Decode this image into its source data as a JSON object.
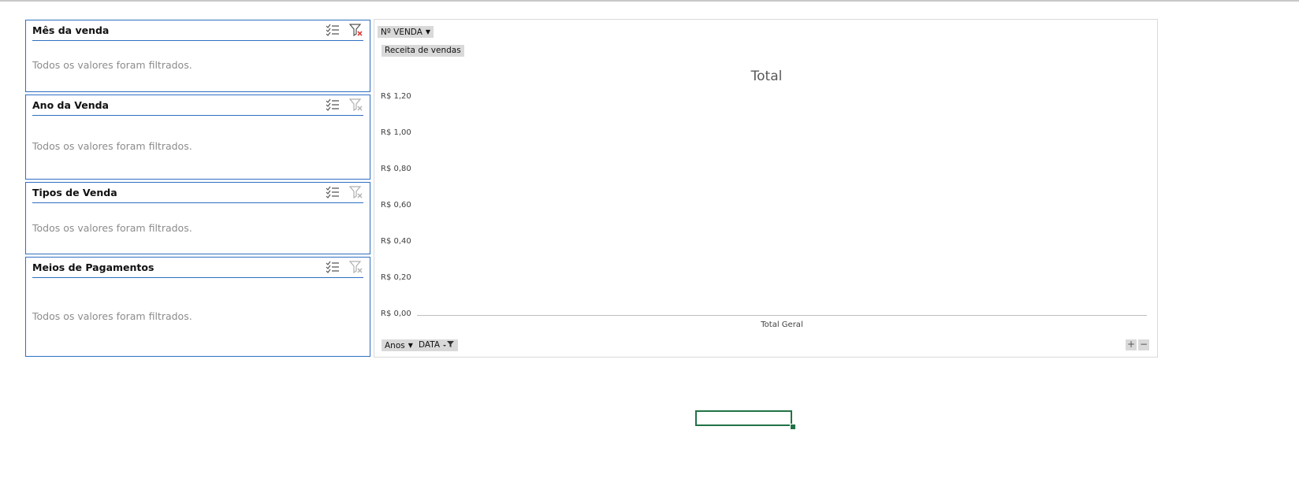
{
  "slicers": [
    {
      "title": "Mês da venda",
      "message": "Todos os valores foram filtrados.",
      "filter_active": true
    },
    {
      "title": "Ano da Venda",
      "message": "Todos os valores foram filtrados.",
      "filter_active": false
    },
    {
      "title": "Tipos de Venda",
      "message": "Todos os valores foram filtrados.",
      "filter_active": false
    },
    {
      "title": "Meios de Pagamentos",
      "message": "Todos os valores foram filtrados.",
      "filter_active": false
    }
  ],
  "pivot_chart": {
    "filter_field": "Nº VENDA",
    "values_field": "Receita de vendas",
    "axis_fields": [
      "Anos",
      "DATA"
    ],
    "zoom_in": "+",
    "zoom_out": "−"
  },
  "chart_data": {
    "type": "bar",
    "title": "Total",
    "categories": [
      "Total Geral"
    ],
    "values": [],
    "ylim": [
      0,
      1.2
    ],
    "yticks": [
      "R$ 1,20",
      "R$ 1,00",
      "R$ 0,80",
      "R$ 0,60",
      "R$ 0,40",
      "R$ 0,20",
      "R$ 0,00"
    ],
    "grid": false
  },
  "colors": {
    "slicer_border": "#2f6fc2",
    "filter_clear_active": "#e0413a",
    "selection": "#217346"
  }
}
